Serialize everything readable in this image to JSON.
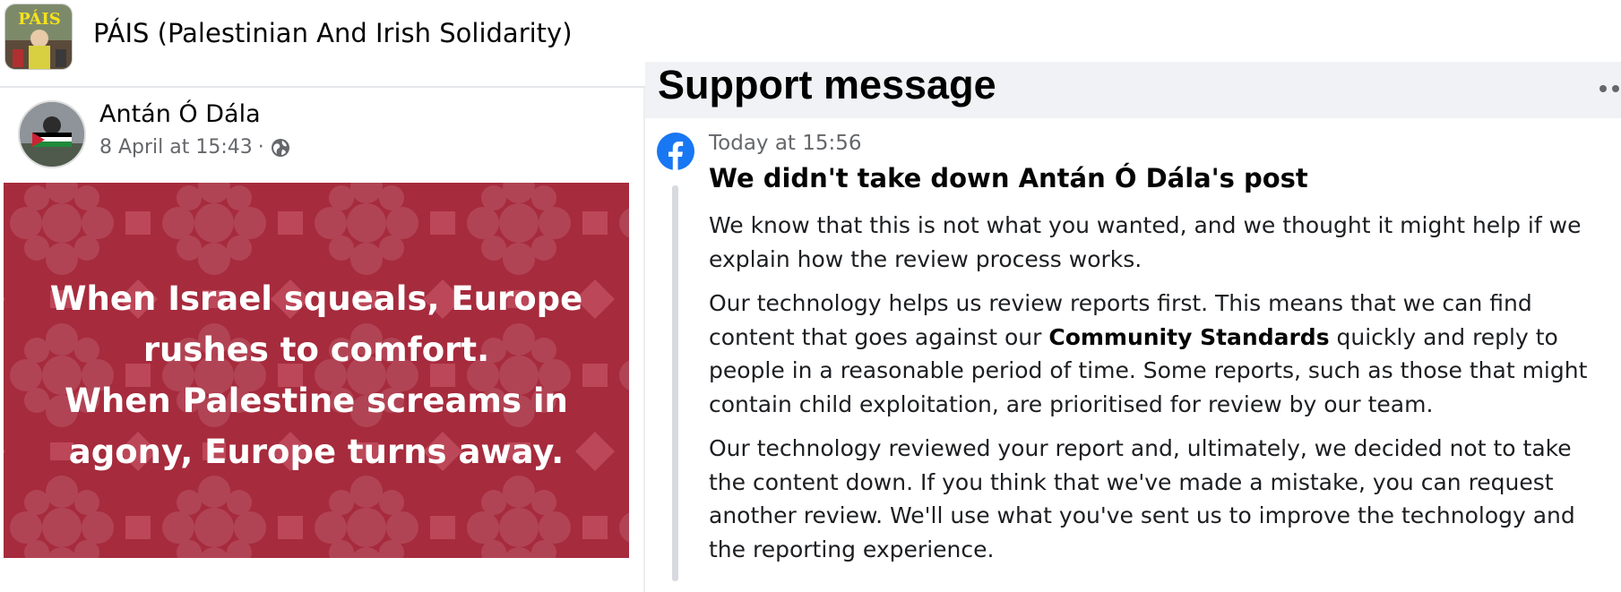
{
  "group": {
    "name": "PÁIS (Palestinian And Irish Solidarity)",
    "avatar_text": "PÁIS",
    "avatar_icon": "group-avatar-image"
  },
  "post": {
    "author": "Antán Ó Dála",
    "date": "8 April at 15:43",
    "separator": "·",
    "privacy_icon": "globe-icon",
    "image_text": [
      "When Israel squeals, Europe",
      "rushes to comfort.",
      "When Palestine screams in",
      "agony, Europe turns away."
    ],
    "image_bg_color": "#a62b3e"
  },
  "support": {
    "title": "Support message",
    "more_icon": "more-options-icon",
    "sender_icon": "facebook-logo-icon",
    "time": "Today at 15:56",
    "headline": "We didn't take down Antán Ó Dála's post",
    "paragraphs": {
      "p1": "We know that this is not what you wanted, and we thought it might help if we explain how the review process works.",
      "p2_before": "Our technology helps us review reports first. This means that we can find content that goes against our ",
      "p2_link": "Community Standards",
      "p2_after": " quickly and reply to people in a reasonable period of time. Some reports, such as those that might contain child exploitation, are prioritised for review by our team.",
      "p3": "Our technology reviewed your report and, ultimately, we decided not to take the content down. If you think that we've made a mistake, you can request another review. We'll use what you've sent us to improve the technology and the reporting experience."
    }
  },
  "colors": {
    "facebook_blue": "#1877f2",
    "header_gray": "#f0f2f5",
    "meta_gray": "#65676b"
  }
}
